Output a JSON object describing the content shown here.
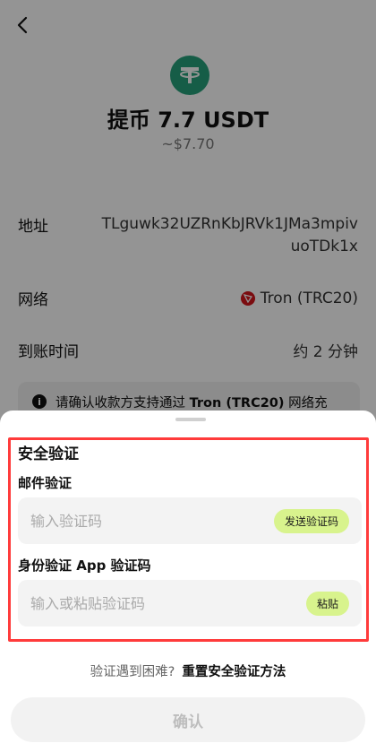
{
  "withdraw": {
    "title": "提币 7.7 USDT",
    "fiat_value": "~$7.70",
    "address_label": "地址",
    "address_value": "TLguwk32UZRnKbJRVk1JMa3mpivuoTDk1x",
    "network_label": "网络",
    "network_value": "Tron (TRC20)",
    "arrival_label": "到账时间",
    "arrival_value": "约 2 分钟",
    "notice_prefix": "请确认收款方支持通过 ",
    "notice_network": "Tron (TRC20)",
    "notice_suffix": " 网络充"
  },
  "sheet": {
    "title": "安全验证",
    "email_label": "邮件验证",
    "email_placeholder": "输入验证码",
    "send_code_button": "发送验证码",
    "app_label": "身份验证 App 验证码",
    "app_placeholder": "输入或粘贴验证码",
    "paste_button": "粘贴",
    "help_question": "验证遇到困难?",
    "help_link": "重置安全验证方法",
    "confirm_button": "确认"
  },
  "colors": {
    "accent_lime": "#d8f38d",
    "usdt_green": "#26a17b",
    "tron_red": "#d4151c",
    "highlight_red": "#ff3b3b"
  },
  "icons": {
    "back": "chevron-left-icon",
    "token": "usdt-icon",
    "network": "tron-icon",
    "info": "info-icon"
  }
}
